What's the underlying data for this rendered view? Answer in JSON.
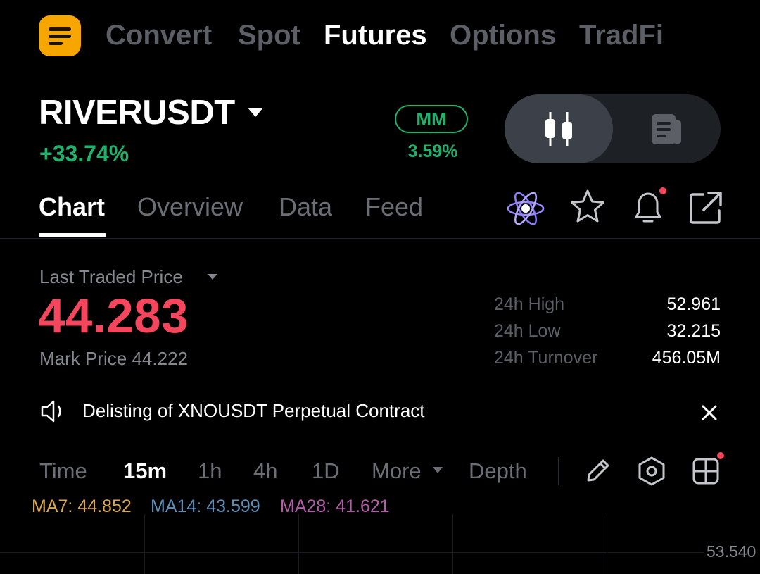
{
  "nav": {
    "tabs": [
      "Convert",
      "Spot",
      "Futures",
      "Options",
      "TradFi"
    ],
    "active": "Futures"
  },
  "symbol": {
    "name": "RIVERUSDT",
    "change": "+33.74%",
    "mm_label": "MM",
    "mm_value": "3.59%"
  },
  "sub_tabs": [
    "Chart",
    "Overview",
    "Data",
    "Feed"
  ],
  "price": {
    "label": "Last Traded Price",
    "last": "44.283",
    "mark": "Mark Price 44.222"
  },
  "stats": [
    {
      "label": "24h High",
      "value": "52.961"
    },
    {
      "label": "24h Low",
      "value": "32.215"
    },
    {
      "label": "24h Turnover",
      "value": "456.05M"
    }
  ],
  "announcement": "Delisting of XNOUSDT Perpetual Contract",
  "timeframes": [
    "Time",
    "15m",
    "1h",
    "4h",
    "1D",
    "More",
    "Depth"
  ],
  "active_timeframe": "15m",
  "ma": [
    {
      "label": "MA7: 44.852",
      "color": "#d9a84c"
    },
    {
      "label": "MA14: 43.599",
      "color": "#5e8fb8"
    },
    {
      "label": "MA28: 41.621",
      "color": "#b25ea9"
    }
  ],
  "chart": {
    "axis_label": "53.540"
  },
  "colors": {
    "up": "#20b26c",
    "down": "#f6465d",
    "accent": "#f7a600"
  },
  "icons": [
    "menu-icon",
    "candlestick-icon",
    "news-icon",
    "ai-atom-icon",
    "star-icon",
    "bell-icon",
    "share-icon",
    "speaker-icon",
    "close-icon",
    "pencil-icon",
    "hexagon-settings-icon",
    "grid-layout-icon"
  ]
}
